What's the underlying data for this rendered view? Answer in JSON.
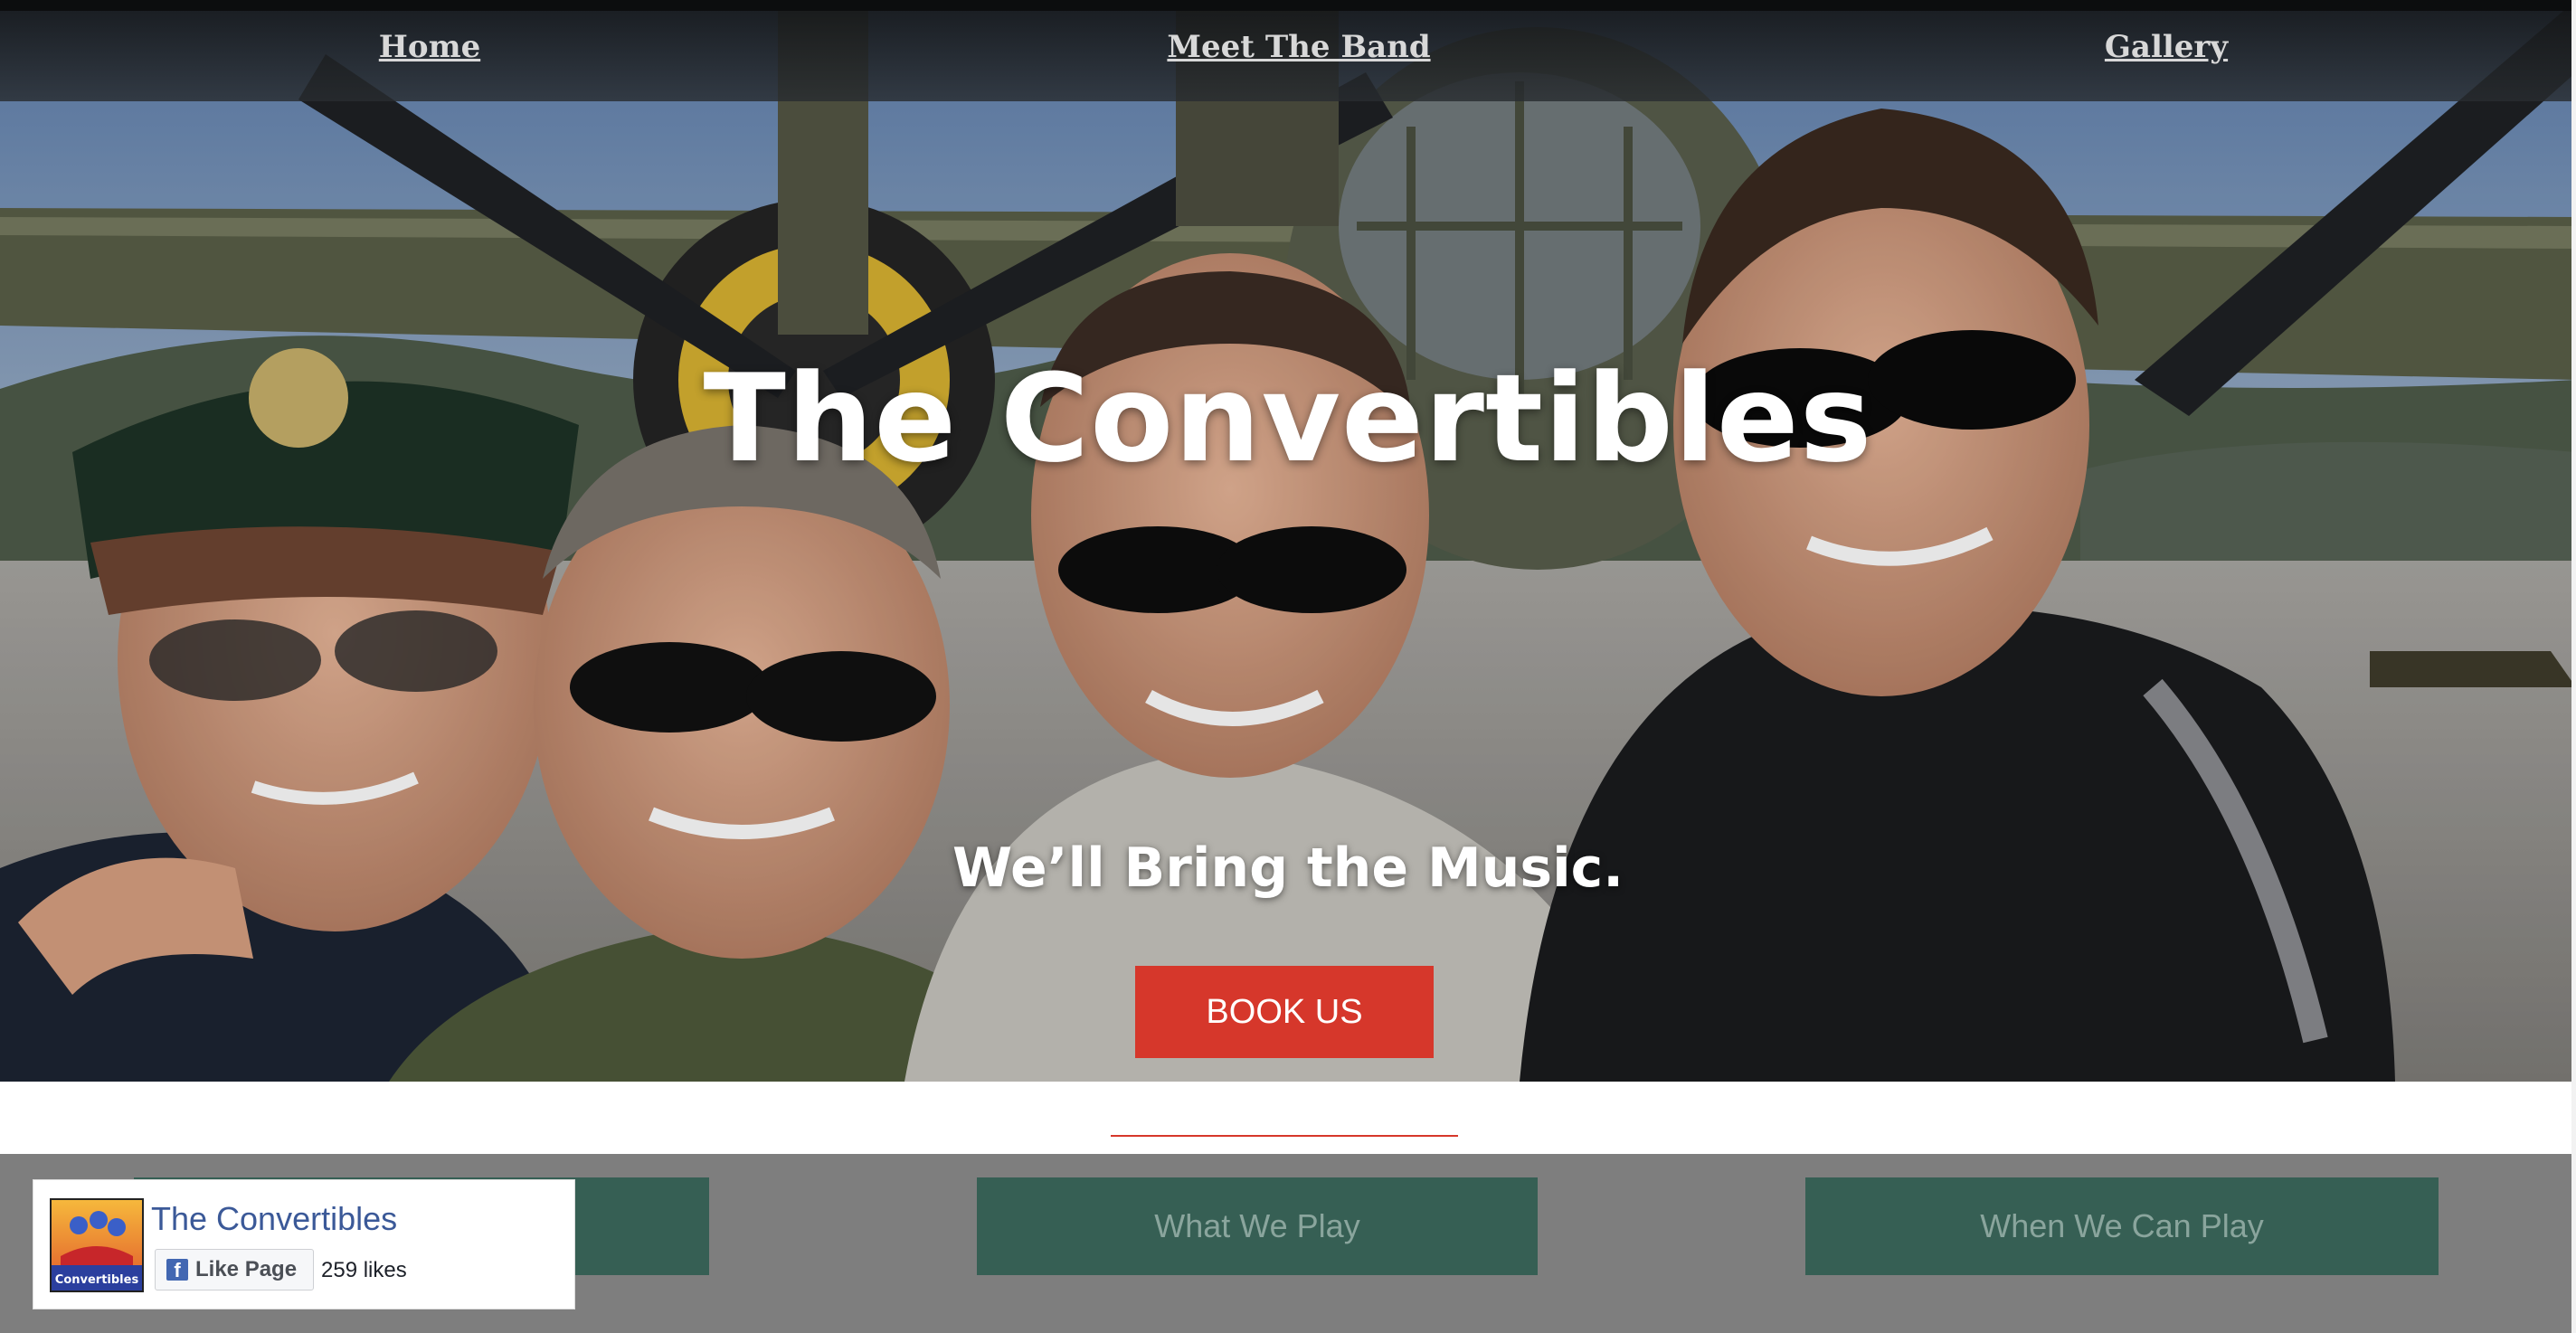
{
  "nav": {
    "home": "Home",
    "meet_the_band": "Meet The Band",
    "gallery": "Gallery"
  },
  "hero": {
    "title": "The Convertibles",
    "tagline": "We’ll Bring the Music.",
    "book_button": "BOOK US"
  },
  "sections": [
    {
      "label": ""
    },
    {
      "label": "What We Play"
    },
    {
      "label": "When We Can Play"
    }
  ],
  "facebook": {
    "page_name": "The Convertibles",
    "like_button": "Like Page",
    "likes": "259 likes",
    "logo_text": "Convertibles"
  },
  "colors": {
    "accent_red": "#d6372b",
    "section_green": "#365f54",
    "band_gray": "#7e7e7e",
    "facebook_blue": "#3b5998"
  },
  "icons": {
    "facebook": "facebook-f-icon"
  }
}
